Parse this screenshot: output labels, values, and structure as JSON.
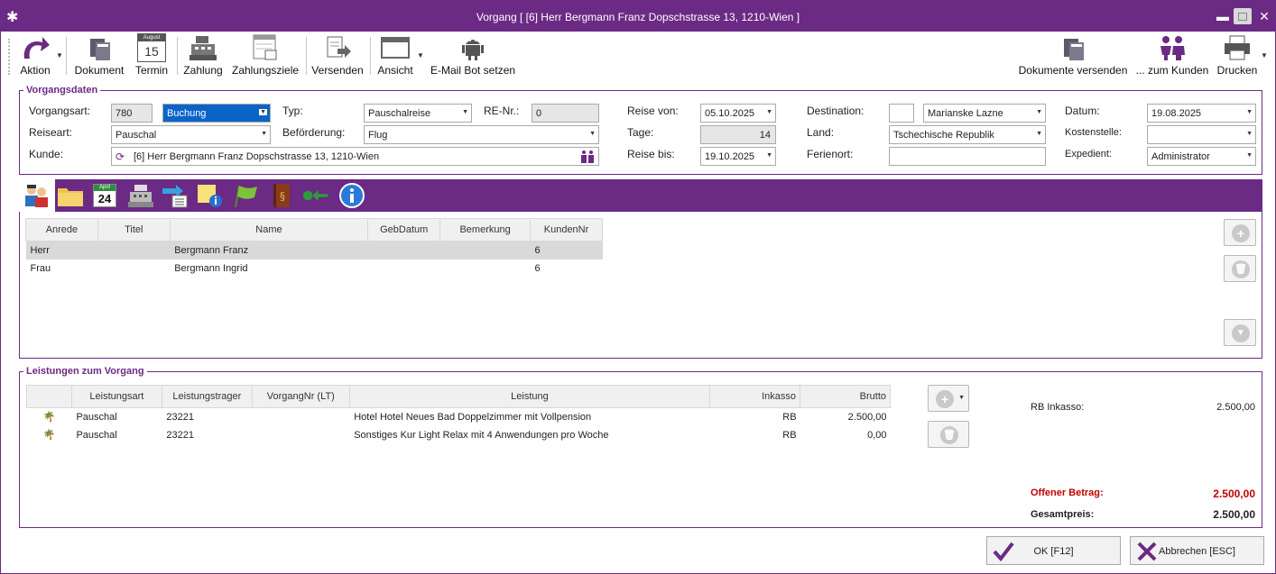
{
  "window": {
    "title": "Vorgang [ [6] Herr Bergmann Franz Dopschstrasse 13, 1210-Wien ]",
    "app_icon": "asterisk-icon",
    "controls": [
      "minimize-icon",
      "maximize-icon",
      "close-icon"
    ]
  },
  "toolbar": {
    "aktion": "Aktion",
    "dokument": "Dokument",
    "termin": "Termin",
    "termin_month": "August",
    "termin_day": "15",
    "zahlung": "Zahlung",
    "zahlungsziele": "Zahlungsziele",
    "versenden": "Versenden",
    "ansicht": "Ansicht",
    "email_bot": "E-Mail Bot setzen",
    "dokumente_versenden": "Dokumente versenden",
    "zum_kunden": "... zum Kunden",
    "drucken": "Drucken"
  },
  "vorgangsdaten": {
    "legend": "Vorgangsdaten",
    "vorgangsart_label": "Vorgangsart:",
    "vorgangsart_nr": "780",
    "vorgangsart_value": "Buchung",
    "typ_label": "Typ:",
    "typ_value": "Pauschalreise",
    "re_nr_label": "RE-Nr.:",
    "re_nr_value": "0",
    "reiseart_label": "Reiseart:",
    "reiseart_value": "Pauschal",
    "befoerderung_label": "Beförderung:",
    "befoerderung_value": "Flug",
    "kunde_label": "Kunde:",
    "kunde_value": "[6] Herr Bergmann Franz Dopschstrasse 13, 1210-Wien",
    "reise_von_label": "Reise von:",
    "reise_von_value": "05.10.2025",
    "tage_label": "Tage:",
    "tage_value": "14",
    "reise_bis_label": "Reise bis:",
    "reise_bis_value": "19.10.2025",
    "destination_label": "Destination:",
    "destination_value": "Marianske Lazne",
    "land_label": "Land:",
    "land_value": "Tschechische Republik",
    "ferienort_label": "Ferienort:",
    "ferienort_value": "",
    "datum_label": "Datum:",
    "datum_value": "19.08.2025",
    "kostenstelle_label": "Kostenstelle:",
    "kostenstelle_value": "",
    "expedient_label": "Expedient:",
    "expedient_value": "Administrator"
  },
  "tabs": {
    "calendar_month": "April",
    "calendar_day": "24",
    "icons": [
      "travellers-icon",
      "folder-icon",
      "calendar-icon",
      "cash-register-icon",
      "list-arrow-icon",
      "note-info-icon",
      "flag-icon",
      "book-icon",
      "arrow-back-icon",
      "info-icon"
    ]
  },
  "persons": {
    "columns": [
      "Anrede",
      "Titel",
      "Name",
      "GebDatum",
      "Bemerkung",
      "KundenNr"
    ],
    "rows": [
      {
        "anrede": "Herr",
        "titel": "",
        "name": "Bergmann Franz",
        "gebdatum": "",
        "bemerkung": "",
        "kundennr": "6"
      },
      {
        "anrede": "Frau",
        "titel": "",
        "name": "Bergmann Ingrid",
        "gebdatum": "",
        "bemerkung": "",
        "kundennr": "6"
      }
    ]
  },
  "leistungen": {
    "legend": "Leistungen zum Vorgang",
    "columns": [
      "",
      "Leistungsart",
      "Leistungstrager",
      "VorgangNr (LT)",
      "Leistung",
      "Inkasso",
      "Brutto"
    ],
    "rows": [
      {
        "icon": "palm-tree-icon",
        "art": "Pauschal",
        "traeger": "23221",
        "vorgangnr": "",
        "leistung": "Hotel Hotel Neues Bad Doppelzimmer mit Vollpension",
        "inkasso": "RB",
        "brutto": "2.500,00"
      },
      {
        "icon": "palm-tree-icon",
        "art": "Pauschal",
        "traeger": "23221",
        "vorgangnr": "",
        "leistung": "Sonstiges Kur Light Relax mit 4 Anwendungen pro Woche",
        "inkasso": "RB",
        "brutto": "0,00"
      }
    ],
    "rb_inkasso_label": "RB Inkasso:",
    "rb_inkasso_value": "2.500,00",
    "offener_label": "Offener Betrag:",
    "offener_value": "2.500,00",
    "gesamt_label": "Gesamtpreis:",
    "gesamt_value": "2.500,00"
  },
  "buttons": {
    "ok": "OK [F12]",
    "abbrechen": "Abbrechen [ESC]"
  },
  "colors": {
    "accent": "#6b2a84",
    "danger": "#c00000",
    "selection": "#0a64c8"
  }
}
